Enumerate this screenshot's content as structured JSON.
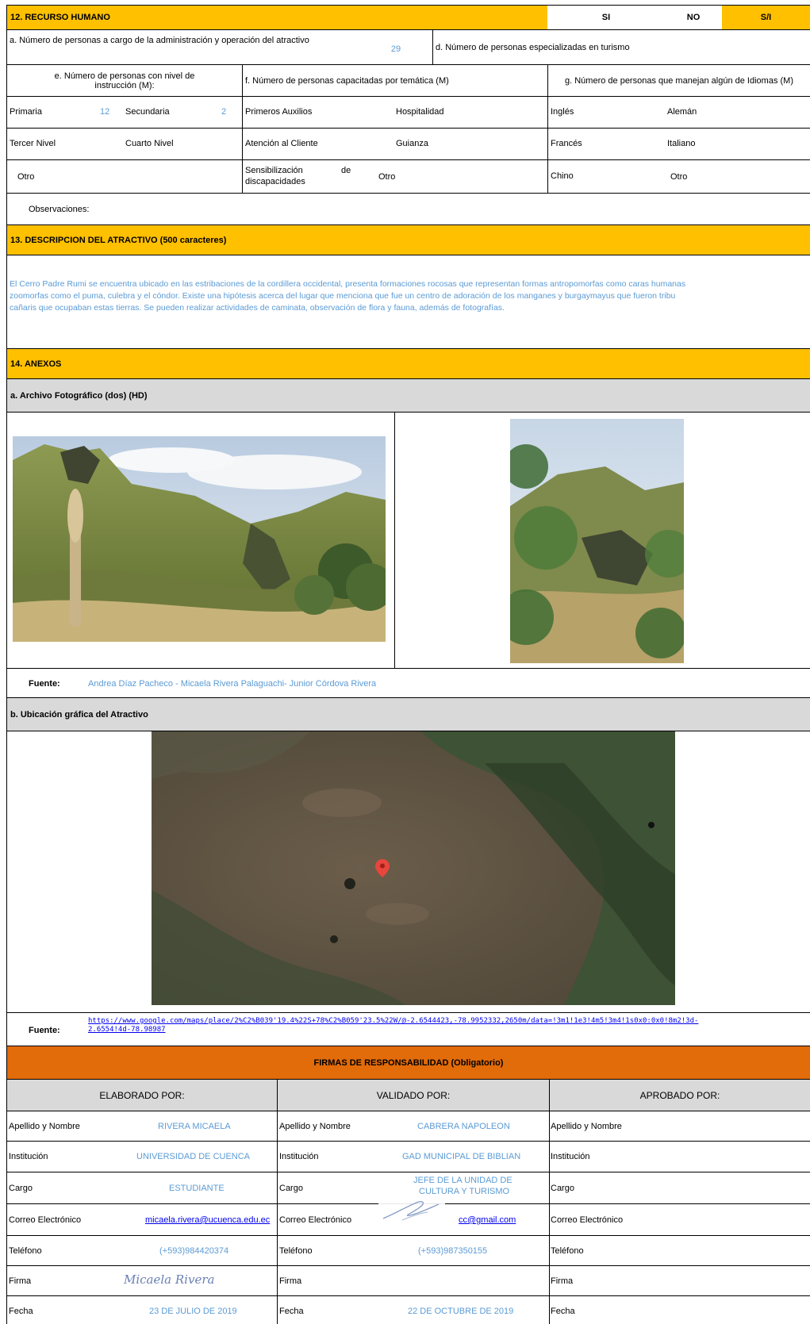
{
  "recurso": {
    "title": "12. RECURSO HUMANO",
    "si": "SI",
    "no": "NO",
    "sin_info": "S/I",
    "a_label": "a. Número de personas a cargo de la administración y operación del atractivo",
    "a_value": "29",
    "d_label": "d. Número de personas especializadas en turismo",
    "e_label": "e. Número de personas con nivel de instrucción (M):",
    "f_label": "f. Número de personas capacitadas por temática (M)",
    "g_label": "g. Número de personas que manejan algún de Idiomas (M)",
    "primaria": "Primaria",
    "primaria_val": "12",
    "secundaria": "Secundaria",
    "secundaria_val": "2",
    "tercer": "Tercer Nivel",
    "cuarto": "Cuarto Nivel",
    "otro_e": "Otro",
    "primeros": "Primeros Auxilios",
    "hospitalidad": "Hospitalidad",
    "atencion": "Atención al Cliente",
    "guianza": "Guianza",
    "sensib_1": "Sensibilización",
    "sensib_de": "de",
    "sensib_2": "discapacidades",
    "otro_f": "Otro",
    "ingles": "Inglés",
    "aleman": "Alemán",
    "frances": "Francés",
    "italiano": "Italiano",
    "chino": "Chino",
    "otro_g": "Otro",
    "observaciones": "Observaciones:"
  },
  "descripcion": {
    "title": "13. DESCRIPCION DEL ATRACTIVO (500 caracteres)",
    "line1": "El Cerro Padre Rumi se encuentra ubicado en las estribaciones de la cordillera occidental, presenta formaciones rocosas que representan formas antropomorfas como caras humanas",
    "line2": "zoomorfas como el puma, culebra y el cóndor. Existe una hipótesis acerca del lugar que menciona que fue un centro de adoración de los manganes y burgaymayus que  fueron tribu",
    "line3": "cañaris que ocupaban estas tierras. Se pueden realizar actividades de caminata, observación de flora y fauna, además de  fotografías."
  },
  "anexos": {
    "title": "14. ANEXOS",
    "archivo": "a. Archivo Fotográfico (dos) (HD)",
    "fuente_label": "Fuente:",
    "fuente_fotos": "Andrea Díaz Pacheco - Micaela Rivera Palaguachi- Junior Córdova Rivera",
    "ubicacion": "b. Ubicación gráfica del Atractivo",
    "fuente_map_1": "https://www.google.com/maps/place/2%C2%B039'19.4%22S+78%C2%B059'23.5%22W/@-2.6544423,-78.9952332,2650m/data=!3m1!1e3!4m5!3m4!1s0x0:0x0!8m2!3d-",
    "fuente_map_2": "2.6554!4d-78.98987"
  },
  "firmas": {
    "title": "FIRMAS DE RESPONSABILIDAD (Obligatorio)",
    "elaborado": "ELABORADO POR:",
    "validado": "VALIDADO POR:",
    "aprobado": "APROBADO POR:",
    "labels": [
      "Apellido y Nombre",
      "Institución",
      "Cargo",
      "Correo Electrónico",
      "Teléfono",
      "Firma",
      "Fecha"
    ],
    "elab_nombre": "RIVERA MICAELA",
    "elab_inst": "UNIVERSIDAD DE CUENCA",
    "elab_cargo": "ESTUDIANTE",
    "elab_correo": "micaela.rivera@ucuenca.edu.ec",
    "elab_tel": "(+593)984420374",
    "elab_firma": "Micaela Rivera",
    "elab_fecha": "23 DE JULIO DE 2019",
    "val_nombre": "CABRERA NAPOLEON",
    "val_inst": "GAD MUNICIPAL DE BIBLIAN",
    "val_cargo_1": "JEFE DE LA UNIDAD DE",
    "val_cargo_2": "CULTURA Y TURISMO",
    "val_correo": "cc@gmail.com",
    "val_tel": "(+593)987350155",
    "val_fecha": "22 DE OCTUBRE DE 2019"
  }
}
